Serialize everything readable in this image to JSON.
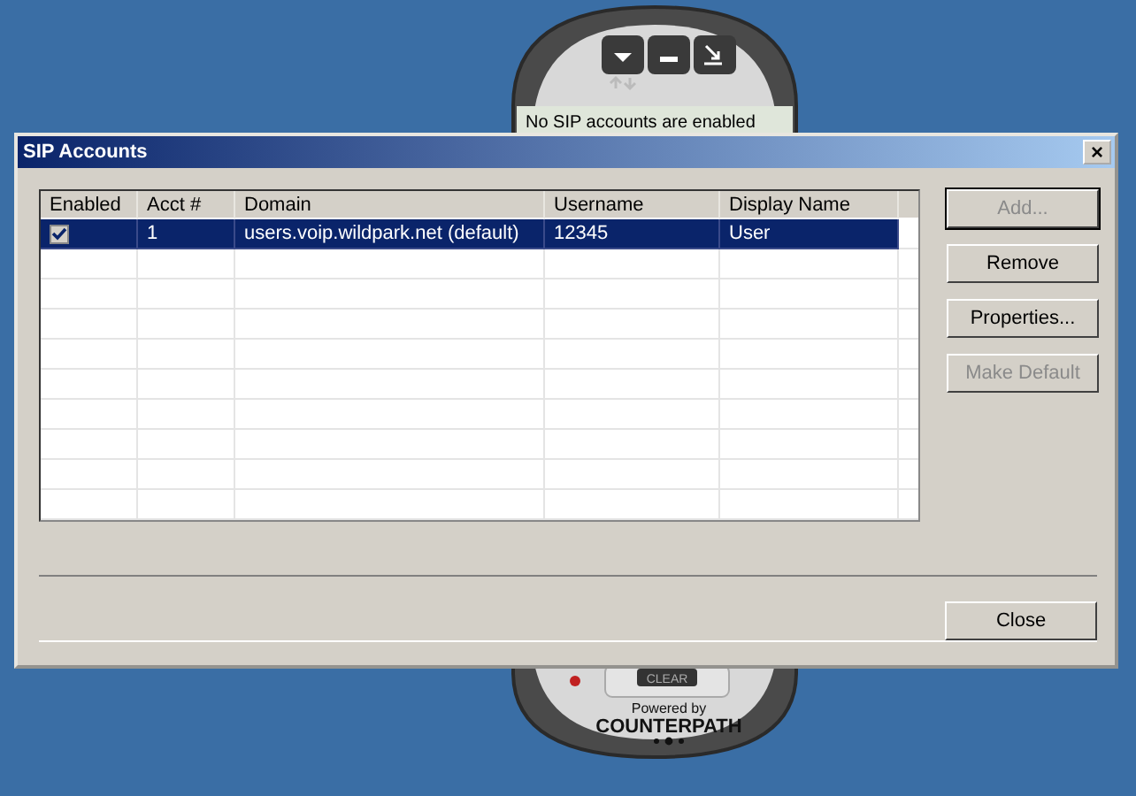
{
  "background_app": {
    "status": "No SIP accounts are enabled",
    "clear_key": "CLEAR",
    "powered_by": "Powered by",
    "brand": "COUNTERPATH"
  },
  "window": {
    "title": "SIP Accounts",
    "close": "×"
  },
  "table": {
    "columns": [
      "Enabled",
      "Acct #",
      "Domain",
      "Username",
      "Display Name"
    ],
    "rows": [
      {
        "enabled": true,
        "selected": true,
        "acct": "1",
        "domain": "users.voip.wildpark.net (default)",
        "username": "12345",
        "display_name": "User"
      }
    ]
  },
  "buttons": [
    {
      "label": "Add...",
      "disabled": true,
      "default": true
    },
    {
      "label": "Remove",
      "disabled": false,
      "default": false
    },
    {
      "label": "Properties...",
      "disabled": false,
      "default": false
    },
    {
      "label": "Make Default",
      "disabled": true,
      "default": false
    }
  ],
  "footer_button": {
    "label": "Close",
    "disabled": false,
    "default": false
  }
}
